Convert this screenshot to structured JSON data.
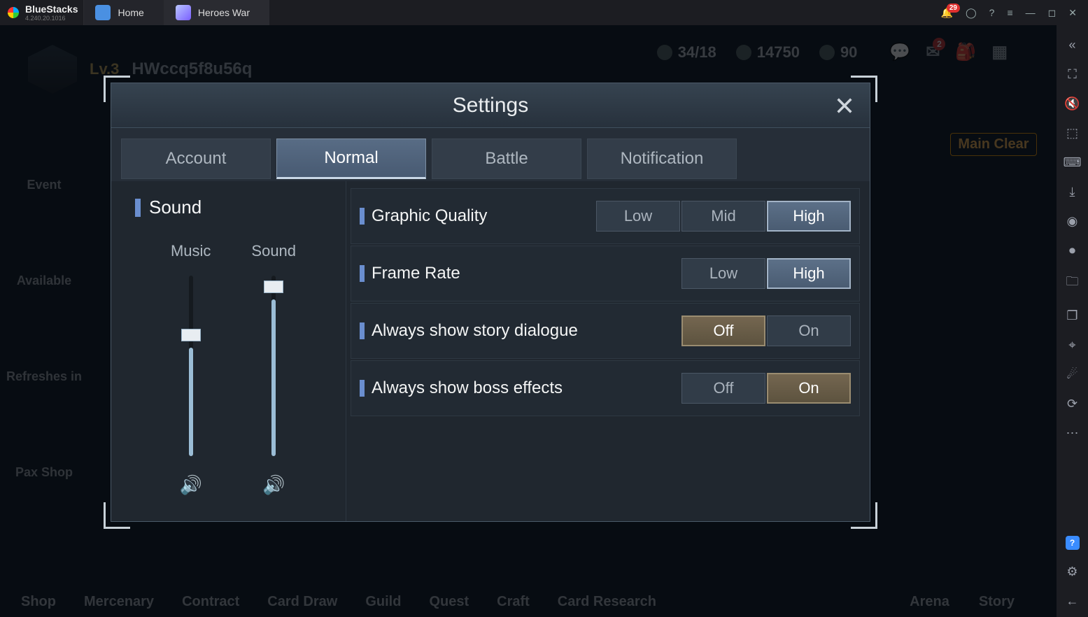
{
  "titlebar": {
    "brand": "BlueStacks",
    "version": "4.240.20.1016",
    "tabs": [
      {
        "label": "Home",
        "icon": "home-icon"
      },
      {
        "label": "Heroes War",
        "icon": "game-icon"
      }
    ],
    "notification_count": "29"
  },
  "right_toolbar": {
    "icons": [
      "collapse-icon",
      "fullscreen-icon",
      "volume-mute-icon",
      "selection-icon",
      "keyboard-icon",
      "download-icon",
      "screenshot-icon",
      "record-icon",
      "folder-icon",
      "multi-instance-icon",
      "location-icon",
      "shake-icon",
      "rotate-icon",
      "more-icon"
    ],
    "bottom_icons": [
      "help-icon",
      "settings-icon",
      "back-icon"
    ]
  },
  "background_game": {
    "level_label": "Lv.3",
    "player_name": "HWccq5f8u56q",
    "energy": "34/18",
    "gold": "14750",
    "gems": "90",
    "left_buttons": [
      "Event",
      "Available",
      "Refreshes in",
      "Pax Shop"
    ],
    "bottom_buttons": [
      "Shop",
      "Mercenary",
      "Contract",
      "Card Draw",
      "Guild",
      "Quest",
      "Craft",
      "Card Research"
    ],
    "bottom_right": [
      "Arena",
      "Story"
    ],
    "clear_label": "Main Clear"
  },
  "settings_dialog": {
    "title": "Settings",
    "tabs": [
      "Account",
      "Normal",
      "Battle",
      "Notification"
    ],
    "active_tab": "Normal",
    "sound_section": {
      "title": "Sound",
      "sliders": [
        {
          "label": "Music",
          "percent": 60
        },
        {
          "label": "Sound",
          "percent": 87
        }
      ]
    },
    "rows": [
      {
        "label": "Graphic Quality",
        "options": [
          "Low",
          "Mid",
          "High"
        ],
        "selected": "High",
        "style": "blue"
      },
      {
        "label": "Frame Rate",
        "options": [
          "Low",
          "High"
        ],
        "selected": "High",
        "style": "blue"
      },
      {
        "label": "Always show story dialogue",
        "options": [
          "Off",
          "On"
        ],
        "selected": "Off",
        "style": "brown"
      },
      {
        "label": "Always show boss effects",
        "options": [
          "Off",
          "On"
        ],
        "selected": "On",
        "style": "brown"
      }
    ]
  }
}
